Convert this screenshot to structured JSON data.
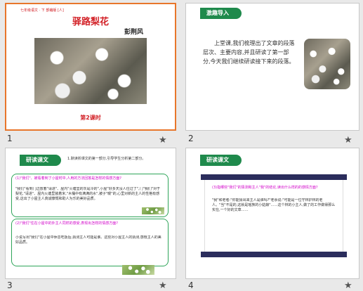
{
  "slides": [
    {
      "number": "1",
      "header_small": "七年级语文 · 下  部编版 [人]",
      "title": "驿路梨花",
      "author": "彭荆风",
      "session": "第2课时"
    },
    {
      "number": "2",
      "tab": "激趣导入",
      "text": "上堂课,我们梳理出了文章的段落层次、主要内容,并且研读了第一部分,今天我们继续研读接下来的段落。"
    },
    {
      "number": "3",
      "tab": "研读课文",
      "intro": "1.默读析课文的第一部分,引导学生分析第二部分。",
      "q1": "(1)\"我们\"、被看着到了小屋时中,人用的方法回答是怎样的情感方面?",
      "a1": "\"我们\"看到门边放着\"请进\"、屋内\"火塘里的灰是冷的\",小屋\"好多天没人住过了\",门\"我们\"对于梨花,\"请进\"、屋内火塘里装着米,\"木桶中有满满的水\",被子\"暖\"的,心里对新的主人的性格有感受,这出了小屋主人真诚慷慨和助人为乐的美好品质。",
      "q2": "(2)\"我们\"住在小屋中的外主人同样的感受,表现出怎样的情感方面?",
      "a2": "小说写出\"我们\"在小屋中休息吃饭后,猜测主人可能是谁。这些对小屋主人的猜测,感慨主人的美好品质。"
    },
    {
      "number": "4",
      "tab": "研读课文",
      "q": "(3)指哪些\"我们\"的猜测和主人\"我\"的结论,读出什么样的的感情方面?",
      "a": "\"我\"和老者:\"你能猜出来主人是谁吗?\"老余说:\"可能是一位守林护林的老人。\"当\"不是的,这就是瑶族的小姑娘\"……这个林的小主人,做了的工作做得那么实在,一个好的文章……"
    }
  ]
}
